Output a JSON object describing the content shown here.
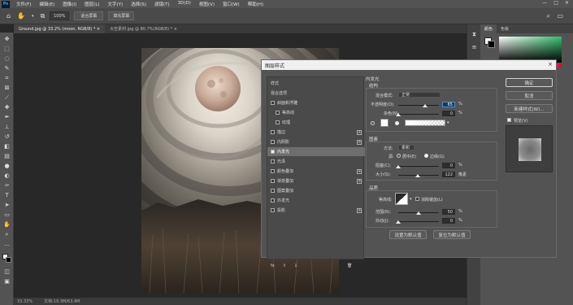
{
  "app": {
    "logo": "Ps"
  },
  "menu": [
    "文件(F)",
    "编辑(E)",
    "图像(I)",
    "图层(L)",
    "文字(Y)",
    "选择(S)",
    "滤镜(T)",
    "3D(D)",
    "视图(V)",
    "窗口(W)",
    "帮助(H)"
  ],
  "window_controls": {
    "minimize": "—",
    "maximize": "□",
    "close": "✕"
  },
  "options_bar": {
    "zoom_value": "100%",
    "fit_screen": "适合屏幕",
    "fill_screen": "填充屏幕"
  },
  "tabs": [
    {
      "label": "Ground.jpg @ 33.2% (moon, RGB/8) * ×"
    },
    {
      "label": "大空素材.jpg @ 80.7%(RGB/8) * ×"
    }
  ],
  "status": {
    "zoom": "33.33%",
    "doc": "文档:19.3M/63.4M"
  },
  "right_panel": {
    "tab_color": "颜色",
    "tab_swatches": "色板"
  },
  "dialog": {
    "title": "图层样式",
    "close": "×",
    "styles_header": "样式",
    "blend_options": "混合选项",
    "style_items": [
      {
        "label": "斜面和浮雕",
        "checked": false,
        "plus": false,
        "indent": false
      },
      {
        "label": "等高线",
        "checked": false,
        "plus": false,
        "indent": true
      },
      {
        "label": "纹理",
        "checked": false,
        "plus": false,
        "indent": true
      },
      {
        "label": "描边",
        "checked": false,
        "plus": true,
        "indent": false
      },
      {
        "label": "内阴影",
        "checked": false,
        "plus": true,
        "indent": false
      },
      {
        "label": "内发光",
        "checked": true,
        "plus": false,
        "indent": false
      },
      {
        "label": "光泽",
        "checked": false,
        "plus": false,
        "indent": false
      },
      {
        "label": "颜色叠加",
        "checked": false,
        "plus": true,
        "indent": false
      },
      {
        "label": "渐变叠加",
        "checked": false,
        "plus": true,
        "indent": false
      },
      {
        "label": "图案叠加",
        "checked": false,
        "plus": false,
        "indent": false
      },
      {
        "label": "外发光",
        "checked": false,
        "plus": false,
        "indent": false
      },
      {
        "label": "投影",
        "checked": false,
        "plus": true,
        "indent": false
      }
    ],
    "footer_fx": "fx",
    "footer_up": "⇧",
    "footer_down": "⇩",
    "footer_trash": "🗑",
    "section_title": "内发光",
    "structure": {
      "title": "结构",
      "blend_mode_label": "混合模式:",
      "blend_mode_value": "正常",
      "opacity_label": "不透明度(O):",
      "opacity_value": "65",
      "opacity_unit": "%",
      "opacity_level": 65,
      "noise_label": "杂色(N):",
      "noise_value": "0",
      "noise_unit": "%",
      "noise_level": 0
    },
    "elements": {
      "title": "图素",
      "method_label": "方法:",
      "method_value": "柔和",
      "source_label": "源:",
      "source_center": "居中(E)",
      "source_edge": "边缘(G)",
      "choke_label": "阻塞(C):",
      "choke_value": "0",
      "choke_unit": "%",
      "choke_level": 0,
      "size_label": "大小(S):",
      "size_value": "122",
      "size_unit": "像素",
      "size_level": 48
    },
    "quality": {
      "title": "品质",
      "contour_label": "等高线:",
      "antialias_label": "消除锯齿(L)",
      "range_label": "范围(R):",
      "range_value": "50",
      "range_unit": "%",
      "range_level": 50,
      "jitter_label": "抖动(J):",
      "jitter_value": "0",
      "jitter_unit": "%",
      "jitter_level": 0
    },
    "set_default": "设置为默认值",
    "reset_default": "复位为默认值",
    "ok": "确定",
    "cancel": "取消",
    "new_style": "新建样式(W)...",
    "preview_label": "预览(V)",
    "preview_checked": true
  },
  "colors": {
    "glow": "#ffffff",
    "accent": "#4a90d9",
    "panel": "#535353"
  }
}
